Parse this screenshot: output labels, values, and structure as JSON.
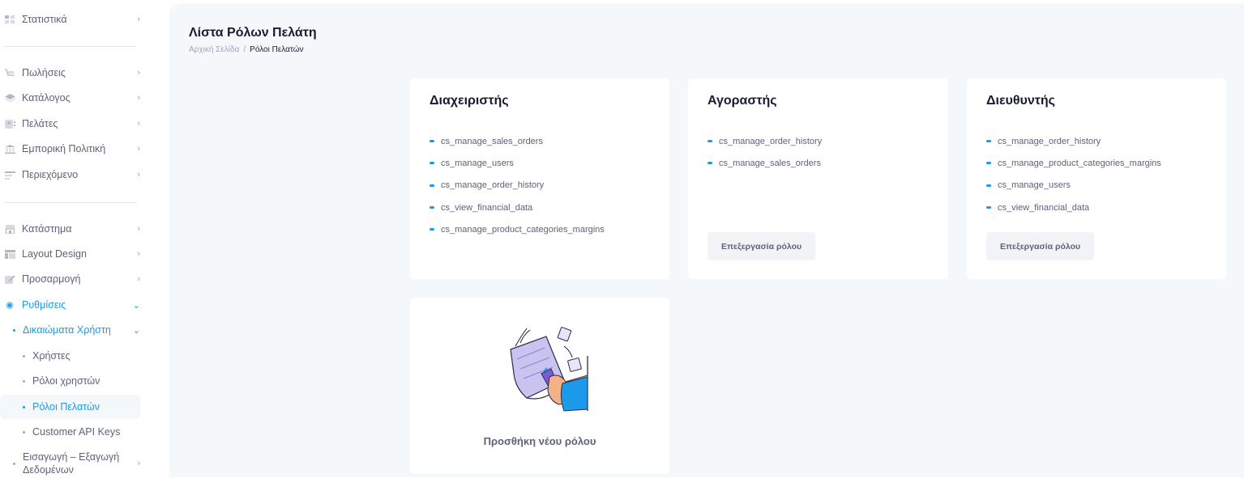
{
  "sidebar": {
    "items": [
      {
        "label": "Στατιστικά",
        "icon": "dashboard-grid-icon"
      },
      {
        "label": "Πωλήσεις",
        "icon": "cart-icon"
      },
      {
        "label": "Κατάλογος",
        "icon": "layers-icon"
      },
      {
        "label": "Πελάτες",
        "icon": "contacts-icon"
      },
      {
        "label": "Εμπορική Πολιτική",
        "icon": "bank-icon"
      },
      {
        "label": "Περιεχόμενο",
        "icon": "text-lines-icon"
      },
      {
        "label": "Κατάστημα",
        "icon": "store-icon"
      },
      {
        "label": "Layout Design",
        "icon": "layout-icon"
      },
      {
        "label": "Προσαρμογή",
        "icon": "pencil-icon"
      },
      {
        "label": "Ρυθμίσεις",
        "icon": "gear-icon"
      }
    ],
    "permissions_group": {
      "label": "Δικαιώματα Χρήστη"
    },
    "sub_items": [
      {
        "label": "Χρήστες"
      },
      {
        "label": "Ρόλοι χρηστών"
      },
      {
        "label": "Ρόλοι Πελατών"
      },
      {
        "label": "Customer API Keys"
      }
    ],
    "import_export": {
      "line1": "Εισαγωγή – Εξαγωγή",
      "line2": "Δεδομένων"
    }
  },
  "header": {
    "title": "Λίστα Ρόλων Πελάτη",
    "breadcrumb": [
      "Αρχική Σελίδα",
      "/",
      "Ρόλοι Πελατών"
    ]
  },
  "roles": [
    {
      "name": "Διαχειριστής",
      "permissions": [
        "cs_manage_sales_orders",
        "cs_manage_users",
        "cs_manage_order_history",
        "cs_view_financial_data",
        "cs_manage_product_categories_margins"
      ]
    },
    {
      "name": "Αγοραστής",
      "permissions": [
        "cs_manage_order_history",
        "cs_manage_sales_orders"
      ],
      "edit_label": "Επεξεργασία ρόλου"
    },
    {
      "name": "Διευθυντής",
      "permissions": [
        "cs_manage_order_history",
        "cs_manage_product_categories_margins",
        "cs_manage_users",
        "cs_view_financial_data"
      ],
      "edit_label": "Επεξεργασία ρόλου"
    }
  ],
  "add_role": {
    "label": "Προσθήκη νέου ρόλου",
    "illustration": "document-hand-illustration"
  },
  "colors": {
    "accent": "#1a9ae8",
    "text_dark": "#181c32",
    "text_muted": "#5e6278",
    "page_bg": "#f5f8fa"
  }
}
